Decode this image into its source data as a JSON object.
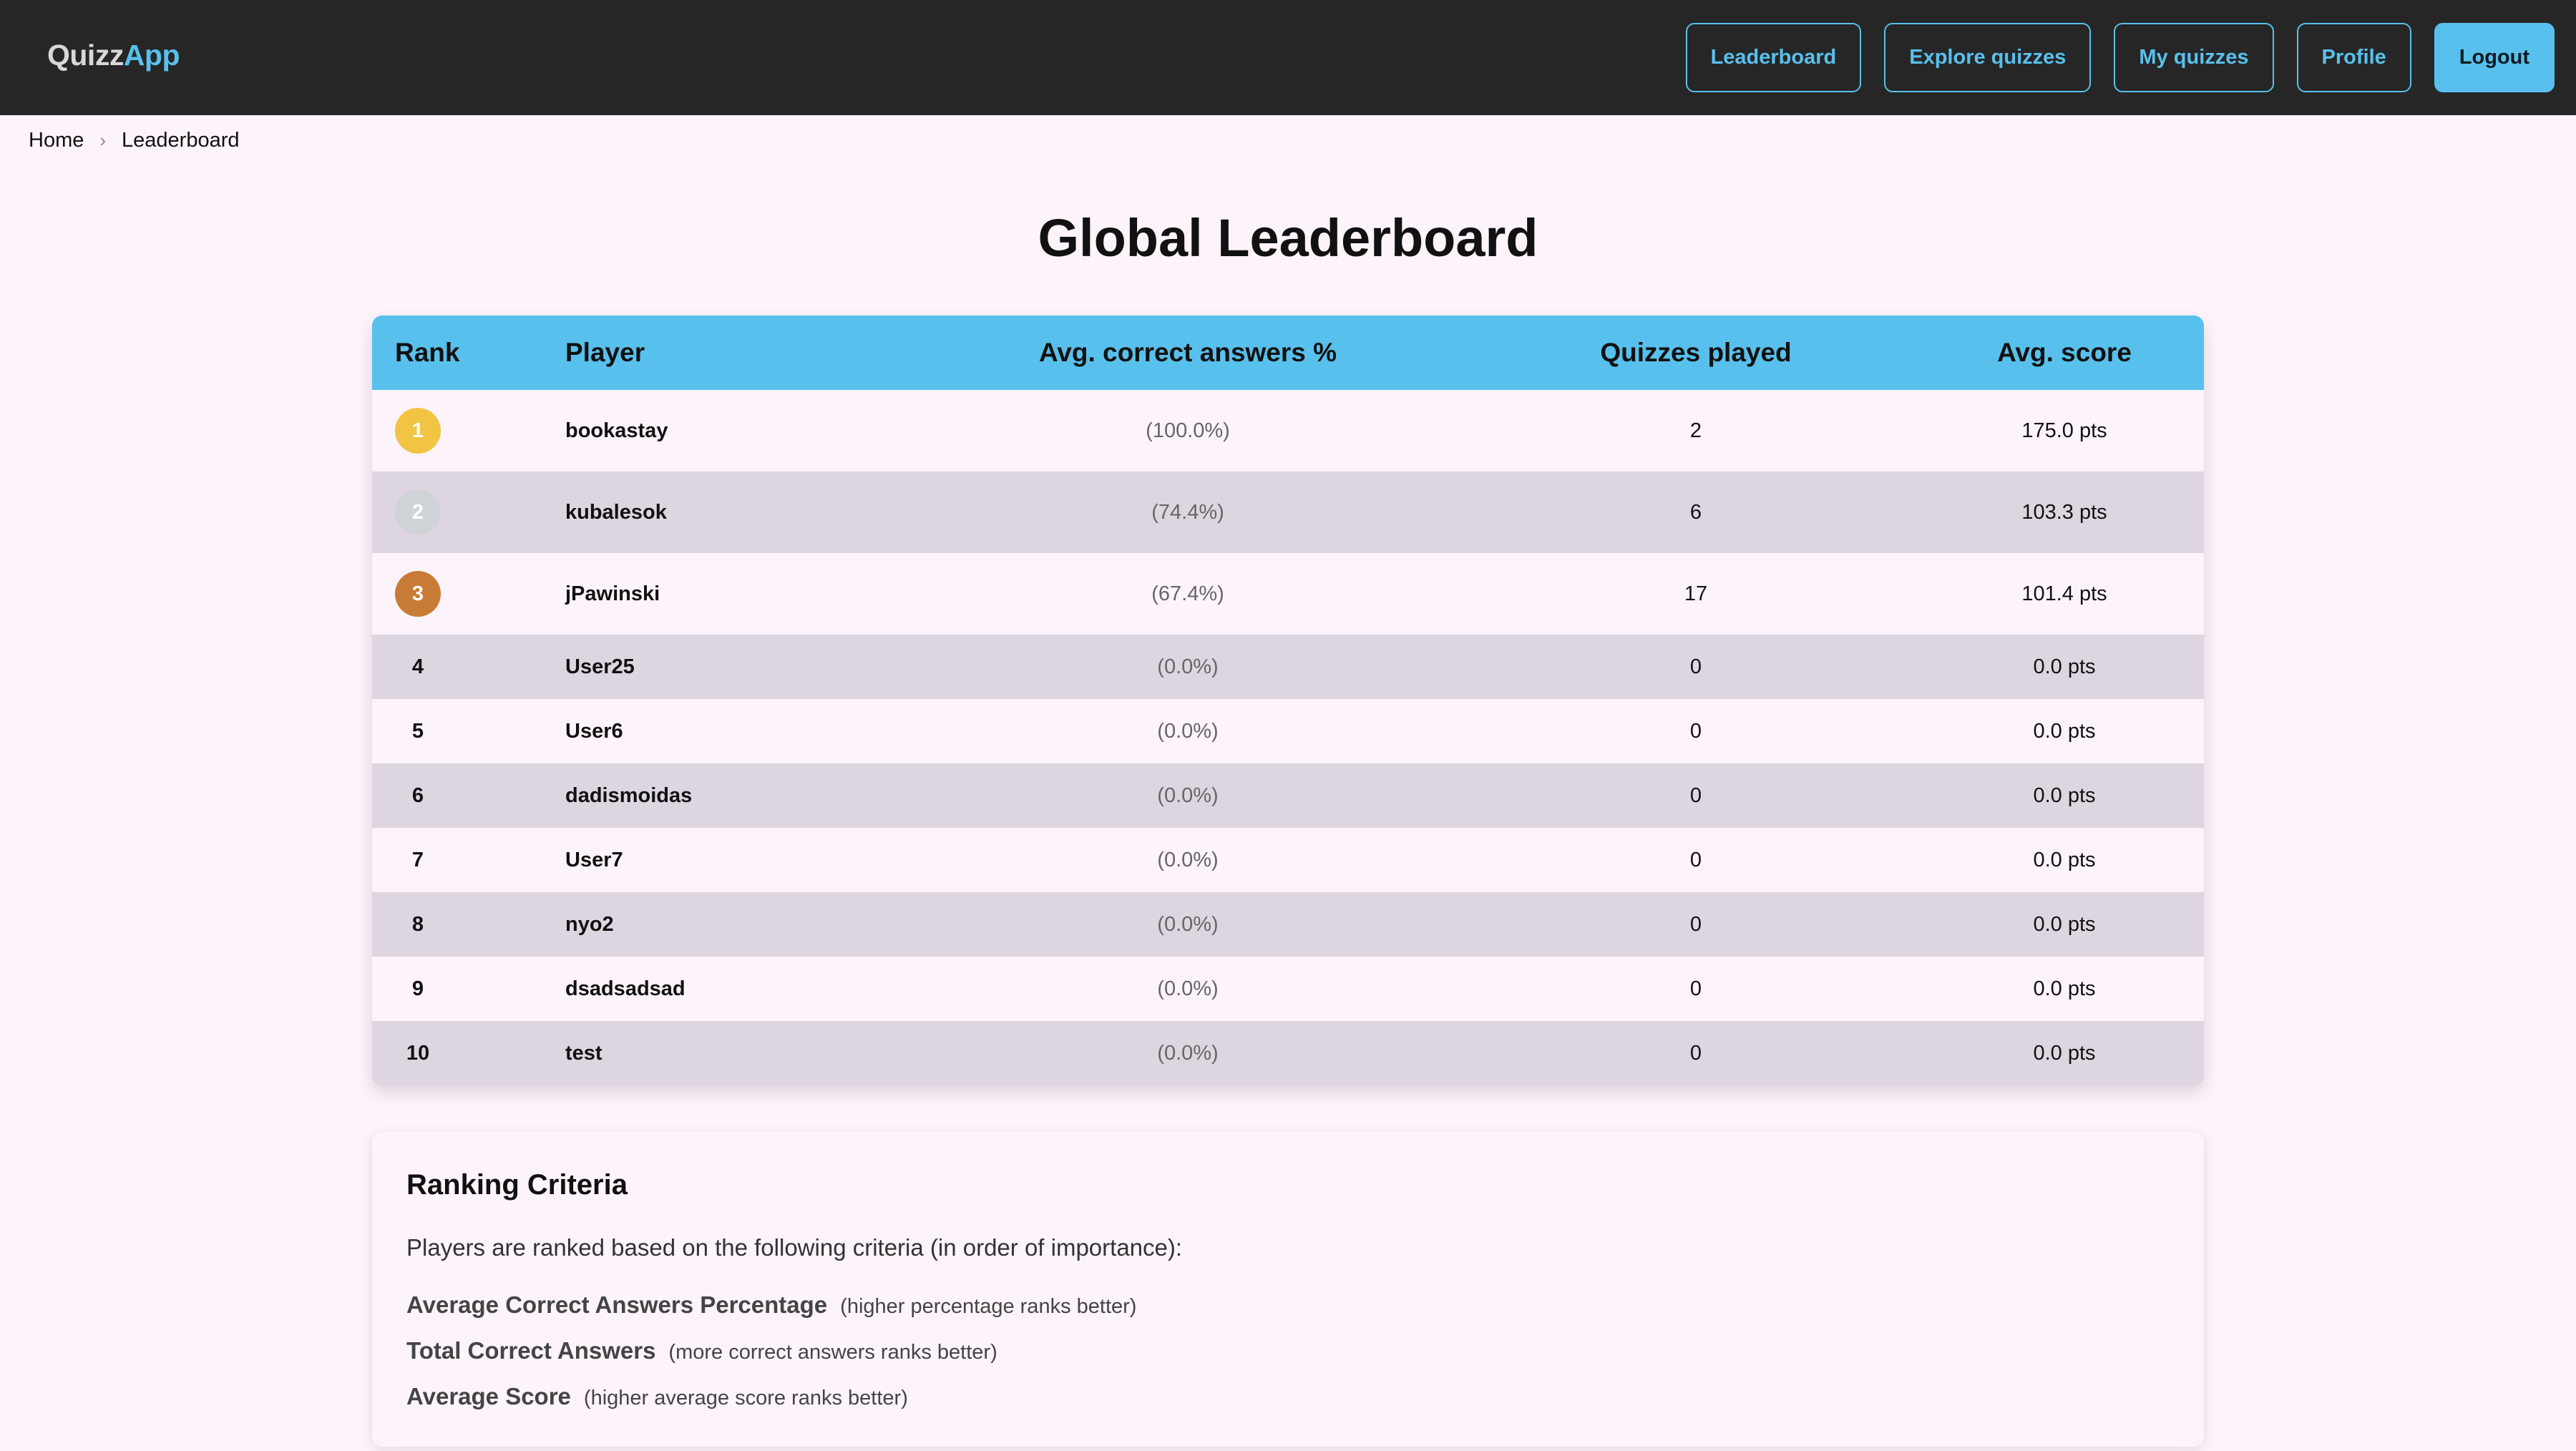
{
  "app": {
    "brand_part1": "Quizz",
    "brand_part2": "App"
  },
  "nav": {
    "leaderboard": "Leaderboard",
    "explore": "Explore quizzes",
    "my_quizzes": "My quizzes",
    "profile": "Profile",
    "logout": "Logout"
  },
  "breadcrumb": {
    "home": "Home",
    "current": "Leaderboard"
  },
  "page_title": "Global Leaderboard",
  "table": {
    "headers": {
      "rank": "Rank",
      "player": "Player",
      "pct": "Avg. correct answers %",
      "played": "Quizzes played",
      "score": "Avg. score"
    },
    "rows": [
      {
        "rank": "1",
        "player": "bookastay",
        "pct": "(100.0%)",
        "played": "2",
        "score": "175.0 pts"
      },
      {
        "rank": "2",
        "player": "kubalesok",
        "pct": "(74.4%)",
        "played": "6",
        "score": "103.3 pts"
      },
      {
        "rank": "3",
        "player": "jPawinski",
        "pct": "(67.4%)",
        "played": "17",
        "score": "101.4 pts"
      },
      {
        "rank": "4",
        "player": "User25",
        "pct": "(0.0%)",
        "played": "0",
        "score": "0.0 pts"
      },
      {
        "rank": "5",
        "player": "User6",
        "pct": "(0.0%)",
        "played": "0",
        "score": "0.0 pts"
      },
      {
        "rank": "6",
        "player": "dadismoidas",
        "pct": "(0.0%)",
        "played": "0",
        "score": "0.0 pts"
      },
      {
        "rank": "7",
        "player": "User7",
        "pct": "(0.0%)",
        "played": "0",
        "score": "0.0 pts"
      },
      {
        "rank": "8",
        "player": "nyo2",
        "pct": "(0.0%)",
        "played": "0",
        "score": "0.0 pts"
      },
      {
        "rank": "9",
        "player": "dsadsadsad",
        "pct": "(0.0%)",
        "played": "0",
        "score": "0.0 pts"
      },
      {
        "rank": "10",
        "player": "test",
        "pct": "(0.0%)",
        "played": "0",
        "score": "0.0 pts"
      }
    ]
  },
  "medal_colors": {
    "gold": "#f2c443",
    "silver": "#d0d3d8",
    "bronze": "#c87b34"
  },
  "criteria": {
    "title": "Ranking Criteria",
    "intro": "Players are ranked based on the following criteria (in order of importance):",
    "items": [
      {
        "name": "Average Correct Answers Percentage",
        "note": "(higher percentage ranks better)"
      },
      {
        "name": "Total Correct Answers",
        "note": "(more correct answers ranks better)"
      },
      {
        "name": "Average Score",
        "note": "(higher average score ranks better)"
      }
    ]
  }
}
